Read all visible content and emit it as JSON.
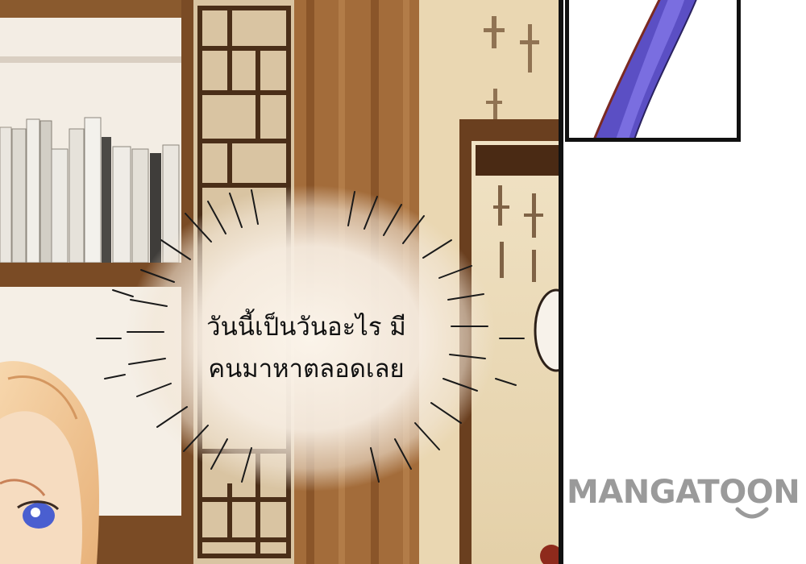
{
  "speech_bubble": {
    "line1": "วันนี้เป็นวันอะไร มี",
    "line2": "คนมาหาตลอดเลย"
  },
  "watermark": {
    "text": "MANGATOON"
  },
  "colors": {
    "panel_border": "#111111",
    "watermark": "#9a9a9a",
    "wood": "#8a5a2e",
    "wall": "#e9d9b8",
    "hair": "#f0c89a",
    "eye": "#4a5fd0",
    "sleeve": "#5b4fc4"
  }
}
